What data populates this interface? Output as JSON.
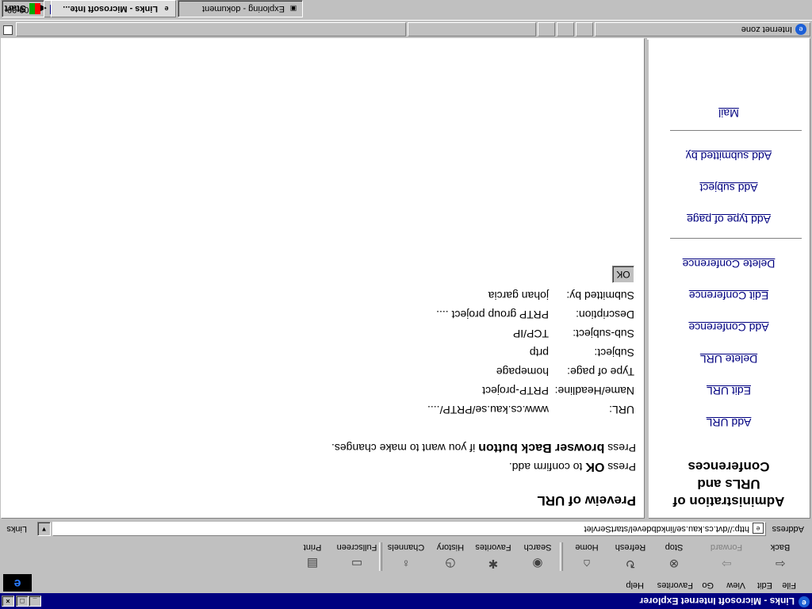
{
  "window": {
    "title": "Links - Microsoft Internet Explorer",
    "min_label": "_",
    "max_label": "□",
    "close_label": "×"
  },
  "menubar": {
    "items": [
      {
        "label": "File"
      },
      {
        "label": "Edit"
      },
      {
        "label": "View"
      },
      {
        "label": "Go"
      },
      {
        "label": "Favorites"
      },
      {
        "label": "Help"
      }
    ],
    "logo_text": "e"
  },
  "toolbar": {
    "back": {
      "label": "Back",
      "icon": "arrow-left-icon",
      "glyph": "⇦"
    },
    "forward": {
      "label": "Forward",
      "icon": "arrow-right-icon",
      "glyph": "⇨"
    },
    "stop": {
      "label": "Stop",
      "icon": "stop-icon",
      "glyph": "⊗"
    },
    "refresh": {
      "label": "Refresh",
      "icon": "refresh-icon",
      "glyph": "↻"
    },
    "home": {
      "label": "Home",
      "icon": "home-icon",
      "glyph": "⌂"
    },
    "search": {
      "label": "Search",
      "icon": "search-icon",
      "glyph": "◉"
    },
    "favorites": {
      "label": "Favorites",
      "icon": "favorites-icon",
      "glyph": "✱"
    },
    "history": {
      "label": "History",
      "icon": "history-icon",
      "glyph": "◷"
    },
    "channels": {
      "label": "Channels",
      "icon": "channels-icon",
      "glyph": "♁"
    },
    "fullscreen": {
      "label": "Fullscreen",
      "icon": "fullscreen-icon",
      "glyph": "▭"
    },
    "print": {
      "label": "Print",
      "icon": "print-icon",
      "glyph": "▤"
    }
  },
  "address": {
    "label": "Address",
    "value": "http://dvt.cs.kau.se/linkdbdevel/startServlet",
    "links_label": "Links"
  },
  "left_frame": {
    "title_lines": [
      "Administration of",
      "URLs and",
      "Conferences"
    ],
    "links": [
      "Add URL",
      "Edit URL",
      "Delete URL",
      "Add Conference",
      "Edit Conference",
      "Delete Conference",
      "Add type of page",
      "Add subject",
      "Add submitted by",
      "Mail"
    ]
  },
  "right_frame": {
    "title": "Preveiw of URL",
    "line1_pre": "Press ",
    "line1_bold": "OK",
    "line1_post": " to confirm add.",
    "line2_pre": "Press ",
    "line2_bold": "browser Back button",
    "line2_post": " if you want to make changes.",
    "fields": [
      {
        "label": "URL:",
        "value": "www.cs.kau.se/PRTP/...."
      },
      {
        "label": "Name/Headline:",
        "value": "PRTP-project"
      },
      {
        "label": "Type of page:",
        "value": "homepage"
      },
      {
        "label": "Subject:",
        "value": "prtp"
      },
      {
        "label": "Sub-subject:",
        "value": "TCP/IP"
      },
      {
        "label": "Description:",
        "value": "PRTP group project ...."
      },
      {
        "label": "Submitted by:",
        "value": "johan garcia"
      }
    ],
    "ok_label": "OK"
  },
  "statusbar": {
    "zone_text": "Internet zone",
    "page_icon": "page-icon"
  },
  "taskbar": {
    "start_label": "Start",
    "tasks": [
      {
        "title": "Links - Microsoft Inte...",
        "active": true
      },
      {
        "title": "Exploring - dokument",
        "active": false
      }
    ],
    "clock": "09:00",
    "tray_icons": [
      "keyboard-icon",
      "speaker-icon"
    ]
  }
}
